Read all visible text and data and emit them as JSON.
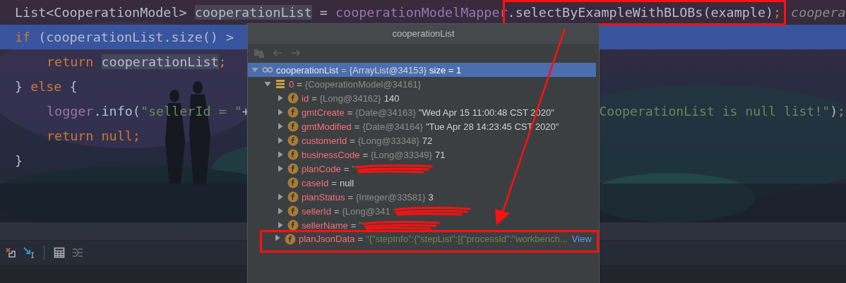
{
  "editor": {
    "lines": [
      {
        "selected": false,
        "indented": false,
        "segments": [
          {
            "kind": "plain",
            "text": "List<CooperationModel> "
          },
          {
            "kind": "plain",
            "text": "cooperationList",
            "highlighted": true
          },
          {
            "kind": "plain",
            "text": " = "
          },
          {
            "kind": "field",
            "text": "cooperationModelMapper"
          },
          {
            "kind": "group",
            "boxed": true,
            "parts": [
              {
                "kind": "plain",
                "text": ".selectByExampleWithBLOBs(example)"
              },
              {
                "kind": "keyword",
                "text": ";"
              }
            ]
          },
          {
            "kind": "hint",
            "text": "coopera"
          }
        ]
      },
      {
        "selected": true,
        "indented": false,
        "segments": [
          {
            "kind": "keyword",
            "text": "if"
          },
          {
            "kind": "plain",
            "text": " (cooperationList.size() >"
          }
        ]
      },
      {
        "selected": false,
        "indented": true,
        "segments": [
          {
            "kind": "keyword",
            "text": "return "
          },
          {
            "kind": "plain",
            "text": "cooperationList",
            "highlighted": true
          },
          {
            "kind": "keyword",
            "text": ";"
          }
        ]
      },
      {
        "selected": false,
        "indented": false,
        "segments": [
          {
            "kind": "plain",
            "text": "} "
          },
          {
            "kind": "keyword",
            "text": "else"
          },
          {
            "kind": "plain",
            "text": " {"
          }
        ]
      },
      {
        "selected": false,
        "indented": true,
        "segments": [
          {
            "kind": "field",
            "text": "logger"
          },
          {
            "kind": "plain",
            "text": ".info("
          },
          {
            "kind": "string",
            "text": "\"sellerId = \""
          },
          {
            "kind": "plain",
            "text": "+"
          }
        ],
        "tail": [
          {
            "kind": "string",
            "text": "CooperationList is null list!\""
          },
          {
            "kind": "plain",
            "text": ")"
          },
          {
            "kind": "keyword",
            "text": ";"
          }
        ]
      },
      {
        "selected": false,
        "indented": true,
        "segments": [
          {
            "kind": "keyword",
            "text": "return null;"
          }
        ]
      },
      {
        "selected": false,
        "indented": false,
        "segments": [
          {
            "kind": "plain",
            "text": "}"
          }
        ]
      }
    ]
  },
  "popup": {
    "title": "cooperationList",
    "tree": [
      {
        "kind": "watch",
        "name": "cooperationList",
        "op": "=",
        "type": "{ArrayList@34153}",
        "value": {
          "kind": "plain",
          "text": "size = 1"
        },
        "expandable": true,
        "expanded": true,
        "selected": true,
        "children": [
          {
            "kind": "array",
            "name": "0",
            "op": "=",
            "type": "{CooperationModel@34161}",
            "expandable": true,
            "expanded": true,
            "selected": false,
            "children": [
              {
                "kind": "field",
                "name": "id",
                "op": "=",
                "type": "{Long@34162}",
                "value": {
                  "kind": "plain",
                  "text": "140"
                },
                "expandable": true,
                "expanded": false,
                "selected": false
              },
              {
                "kind": "field",
                "name": "gmtCreate",
                "op": "=",
                "type": "{Date@34163}",
                "value": {
                  "kind": "plain",
                  "text": "\"Wed Apr 15 11:00:48 CST 2020\""
                },
                "expandable": true,
                "expanded": false,
                "selected": false
              },
              {
                "kind": "field",
                "name": "gmtModified",
                "op": "=",
                "type": "{Date@34164}",
                "value": {
                  "kind": "plain",
                  "text": "\"Tue Apr 28 14:23:45 CST 2020\""
                },
                "expandable": true,
                "expanded": false,
                "selected": false
              },
              {
                "kind": "field",
                "name": "customerId",
                "op": "=",
                "type": "{Long@33348}",
                "value": {
                  "kind": "plain",
                  "text": "72"
                },
                "expandable": true,
                "expanded": false,
                "selected": false
              },
              {
                "kind": "field",
                "name": "businessCode",
                "op": "=",
                "type": "{Long@33349}",
                "value": {
                  "kind": "plain",
                  "text": "71"
                },
                "expandable": true,
                "expanded": false,
                "selected": false
              },
              {
                "kind": "field",
                "name": "planCode",
                "op": "=",
                "value": {
                  "kind": "string",
                  "text": "\""
                },
                "redacted": true,
                "expandable": true,
                "expanded": false,
                "selected": false
              },
              {
                "kind": "field",
                "name": "caseId",
                "op": "=",
                "value": {
                  "kind": "plain",
                  "text": "null"
                },
                "expandable": false,
                "expanded": false,
                "selected": false
              },
              {
                "kind": "field",
                "name": "planStatus",
                "op": "=",
                "type": "{Integer@33581}",
                "value": {
                  "kind": "plain",
                  "text": "3"
                },
                "expandable": true,
                "expanded": false,
                "selected": false
              },
              {
                "kind": "field",
                "name": "sellerId",
                "op": "=",
                "type": "{Long@341",
                "redacted": true,
                "expandable": true,
                "expanded": false,
                "selected": false
              },
              {
                "kind": "field",
                "name": "sellerName",
                "op": "=",
                "value": {
                  "kind": "string",
                  "text": "\""
                },
                "redacted": true,
                "expandable": true,
                "expanded": false,
                "selected": false
              },
              {
                "kind": "field",
                "name": "planJsonData",
                "op": "=",
                "value": {
                  "kind": "string",
                  "text": "\"{\"stepInfo\":{\"stepList\":[{\"processId\":\"workbench..."
                },
                "link": "View",
                "boxed": true,
                "expandable": true,
                "expanded": false,
                "selected": false
              }
            ]
          }
        ]
      }
    ]
  },
  "arrow": true
}
